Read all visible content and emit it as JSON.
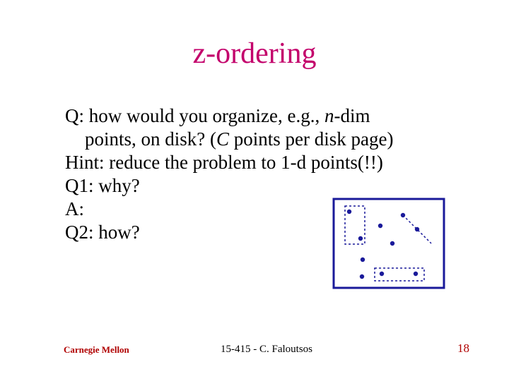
{
  "title": "z-ordering",
  "body": {
    "line1_a": "Q: how would you organize, e.g., ",
    "line1_n": "n",
    "line1_b": "-dim",
    "line2_a": "points, on disk? (",
    "line2_c": "C",
    "line2_b": " points per disk page)",
    "line3": "Hint: reduce the problem to 1-d points(!!)",
    "line4": "Q1: why?",
    "line5": "A:",
    "line6": "Q2: how?"
  },
  "footer": {
    "left": "Carnegie Mellon",
    "center": "15-415 - C. Faloutsos",
    "right": "18"
  }
}
